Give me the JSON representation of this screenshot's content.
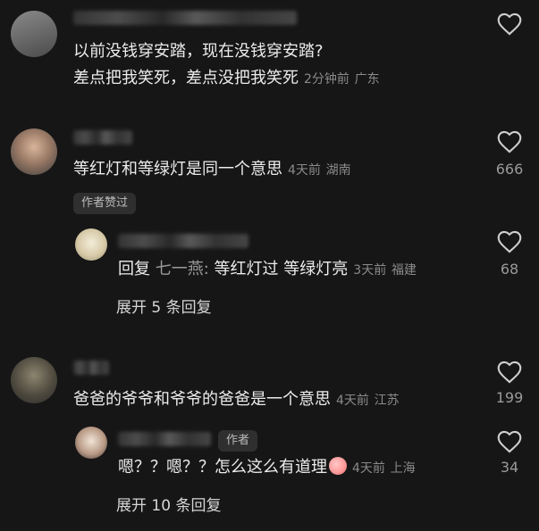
{
  "comments": [
    {
      "text_line1": "以前没钱穿安踏，现在没钱穿安踏?",
      "text_line2": "差点把我笑死，差点没把我笑死",
      "time": "2分钟前",
      "location": "广东"
    },
    {
      "text": "等红灯和等绿灯是同一个意思",
      "time": "4天前",
      "location": "湖南",
      "likes": "666",
      "author_liked_tag": "作者赞过",
      "reply": {
        "label": "回复",
        "target": "七一燕:",
        "text": "等红灯过  等绿灯亮",
        "time": "3天前",
        "location": "福建",
        "likes": "68"
      },
      "expand": "展开 5 条回复"
    },
    {
      "text": "爸爸的爷爷和爷爷的爸爸是一个意思",
      "time": "4天前",
      "location": "江苏",
      "likes": "199",
      "reply": {
        "author_tag": "作者",
        "text": "嗯？？嗯？？怎么这么有道理",
        "time": "4天前",
        "location": "上海",
        "likes": "34"
      },
      "expand": "展开 10 条回复"
    }
  ]
}
